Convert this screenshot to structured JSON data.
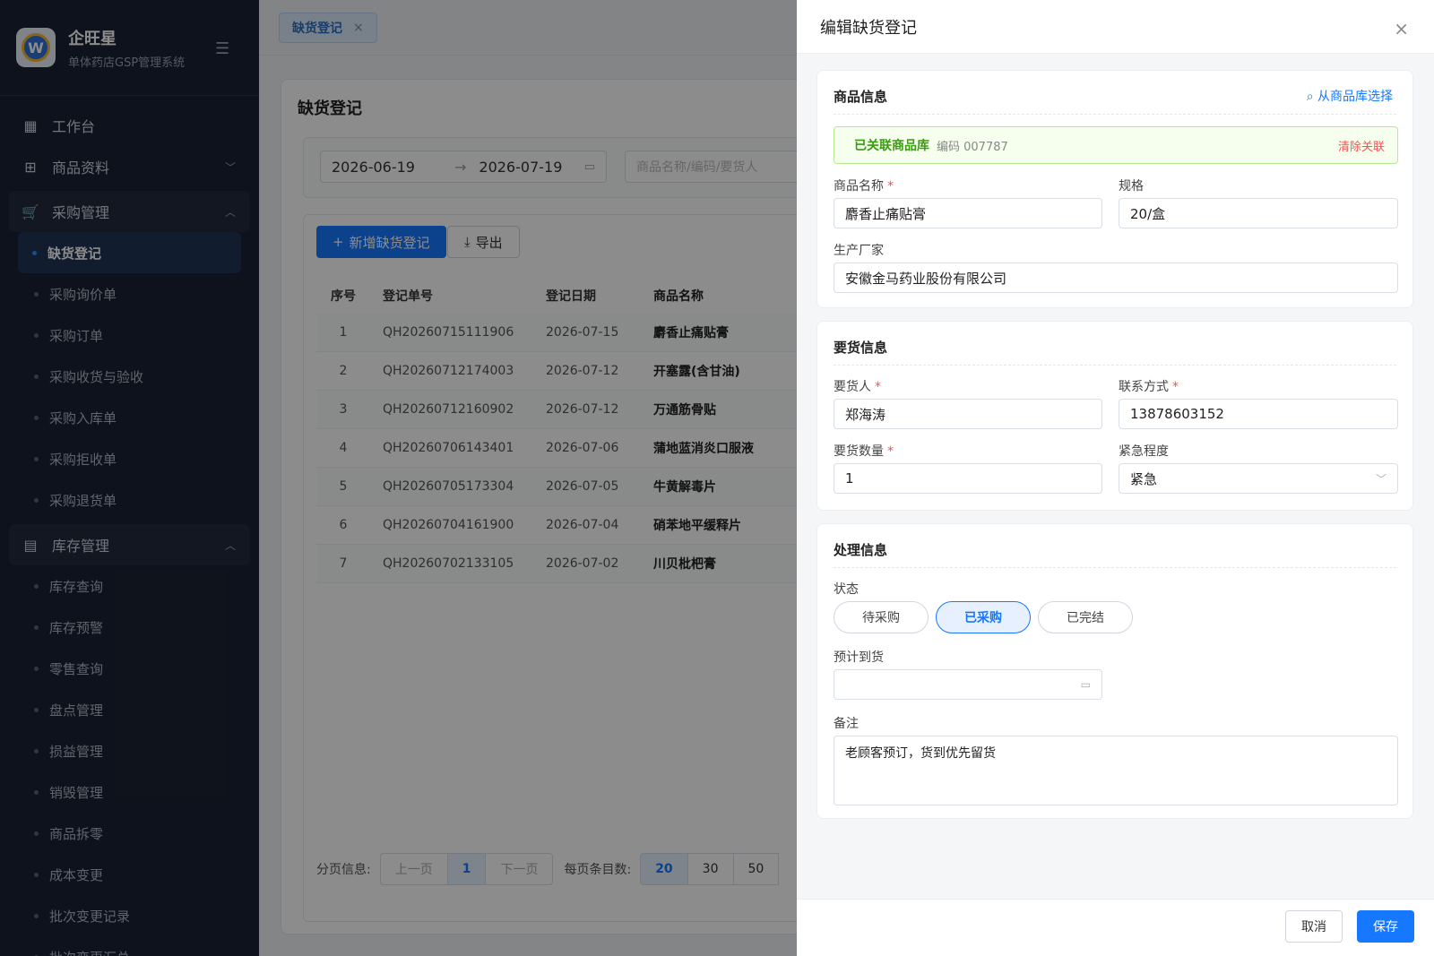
{
  "brand": {
    "name": "企旺星",
    "subtitle": "单体药店GSP管理系统",
    "logo_letter": "W"
  },
  "sidebar": {
    "items": [
      {
        "label": "工作台",
        "icon": "dashboard-icon"
      },
      {
        "label": "商品资料",
        "icon": "product-icon"
      }
    ],
    "purchase_group": {
      "label": "采购管理",
      "icon": "cart-icon",
      "children": [
        "缺货登记",
        "采购询价单",
        "采购订单",
        "采购收货与验收",
        "采购入库单",
        "采购拒收单",
        "采购退货单"
      ]
    },
    "inventory_group": {
      "label": "库存管理",
      "icon": "box-icon",
      "children": [
        "库存查询",
        "库存预警",
        "零售查询",
        "盘点管理",
        "损益管理",
        "销毁管理",
        "商品拆零",
        "成本变更",
        "批次变更记录",
        "批次变更汇总"
      ]
    }
  },
  "tab": {
    "label": "缺货登记",
    "close": "×"
  },
  "page": {
    "title": "缺货登记",
    "date_start": "2026-06-19",
    "date_end": "2026-07-19",
    "date_arrow": "→",
    "search_placeholder": "商品名称/编码/要货人",
    "add_button": "新增缺货登记",
    "export_button": "导出",
    "table": {
      "headers": [
        "序号",
        "登记单号",
        "登记日期",
        "商品名称"
      ],
      "rows": [
        [
          "1",
          "QH20260715111906",
          "2026-07-15",
          "麝香止痛贴膏"
        ],
        [
          "2",
          "QH20260712174003",
          "2026-07-12",
          "开塞露(含甘油)"
        ],
        [
          "3",
          "QH20260712160902",
          "2026-07-12",
          "万通筋骨贴"
        ],
        [
          "4",
          "QH20260706143401",
          "2026-07-06",
          "蒲地蓝消炎口服液"
        ],
        [
          "5",
          "QH20260705173304",
          "2026-07-05",
          "牛黄解毒片"
        ],
        [
          "6",
          "QH20260704161900",
          "2026-07-04",
          "硝苯地平缓释片"
        ],
        [
          "7",
          "QH20260702133105",
          "2026-07-02",
          "川贝枇杷膏"
        ]
      ]
    },
    "pager": {
      "info_label": "分页信息:",
      "prev": "上一页",
      "current": "1",
      "next": "下一页",
      "size_label": "每页条目数:",
      "sizes": [
        "20",
        "30",
        "50"
      ]
    }
  },
  "drawer": {
    "title": "编辑缺货登记",
    "close": "×",
    "product": {
      "section_title": "商品信息",
      "pick_link": "从商品库选择",
      "linked_status": "已关联商品库",
      "linked_code": "编码 007787",
      "clear_link": "清除关联",
      "name_label": "商品名称",
      "name_value": "麝香止痛贴膏",
      "spec_label": "规格",
      "spec_value": "20/盒",
      "maker_label": "生产厂家",
      "maker_value": "安徽金马药业股份有限公司"
    },
    "request": {
      "section_title": "要货信息",
      "person_label": "要货人",
      "person_value": "郑海涛",
      "contact_label": "联系方式",
      "contact_value": "13878603152",
      "qty_label": "要货数量",
      "qty_value": "1",
      "urgency_label": "紧急程度",
      "urgency_value": "紧急"
    },
    "process": {
      "section_title": "处理信息",
      "status_label": "状态",
      "statuses": [
        "待采购",
        "已采购",
        "已完结"
      ],
      "selected_status": "已采购",
      "eta_label": "预计到货",
      "eta_value": "",
      "note_label": "备注",
      "note_value": "老顾客预订，货到优先留货"
    },
    "cancel_button": "取消",
    "save_button": "保存"
  },
  "colors": {
    "primary": "#1677ff",
    "sidebar_bg": "#1a2233",
    "success": "#389e0d",
    "danger": "#ff4d4f"
  }
}
